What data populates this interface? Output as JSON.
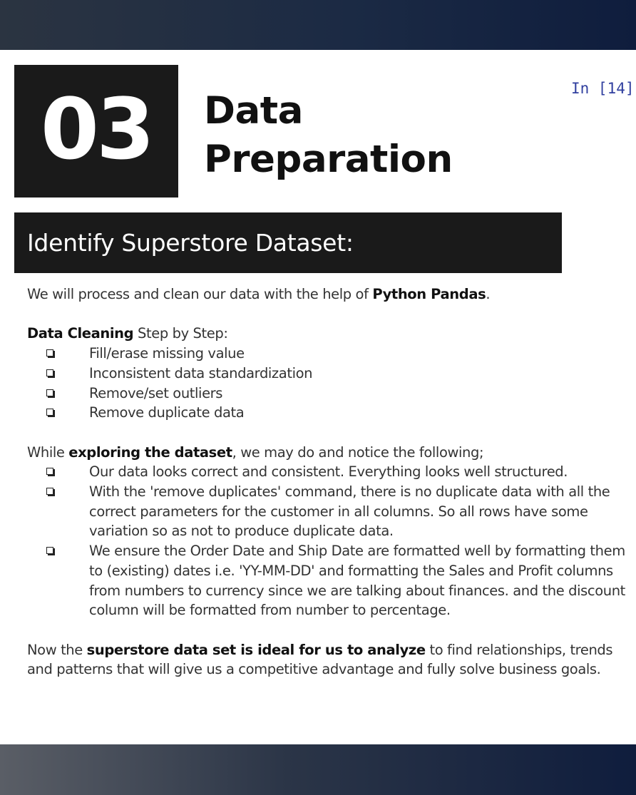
{
  "section_number": "03",
  "title": {
    "line1": "Data",
    "line2": "Preparation"
  },
  "notebook_prompt": "In [14]",
  "section_heading": "Identify Superstore Dataset:",
  "intro": {
    "before": "We will process and clean our data with the help of ",
    "bold": "Python Pandas",
    "after": "."
  },
  "cleaning": {
    "bold": "Data Cleaning",
    "rest": " Step by Step:",
    "items": [
      "Fill/erase missing value",
      "Inconsistent data standardization",
      "Remove/set outliers",
      "Remove duplicate data"
    ]
  },
  "exploring": {
    "before": "While ",
    "bold": "exploring the dataset",
    "after": ", we may do and notice the following;",
    "items": [
      "Our data looks correct and consistent. Everything looks well structured.",
      "With the 'remove duplicates' command, there is no duplicate data with all the correct parameters for the customer in all columns. So all rows have some variation so as not to produce duplicate data.",
      "We ensure the Order Date and Ship Date are formatted well by formatting them to (existing) dates i.e. 'YY-MM-DD' and formatting the Sales and Profit columns from numbers to currency since we are talking about finances. and the discount column will be formatted from number to percentage."
    ]
  },
  "conclusion": {
    "before": "Now the ",
    "bold": "superstore data set is ideal for us to analyze",
    "after": " to find relationships, trends and patterns that will give us a competitive advantage and fully solve business goals."
  },
  "icons": {
    "checkbox": "checkbox-icon"
  }
}
